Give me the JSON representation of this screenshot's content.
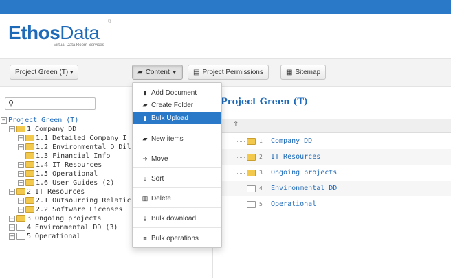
{
  "brand": {
    "word1": "Ethos",
    "word2": "Data",
    "tagline": "Virtual Data Room Services",
    "reg": "®"
  },
  "toolbar": {
    "room_select": "Project Green (T)",
    "content_label": "Content",
    "permissions_label": "Project Permissions",
    "sitemap_label": "Sitemap"
  },
  "menu": [
    {
      "label": "Add Document",
      "icon": "file-icon"
    },
    {
      "label": "Create Folder",
      "icon": "folder-icon"
    },
    {
      "label": "Bulk Upload",
      "icon": "files-icon",
      "highlighted": true
    },
    {
      "label": "New items",
      "icon": "new-folder-icon"
    },
    {
      "label": "Move",
      "icon": "arrow-right-icon"
    },
    {
      "label": "Sort",
      "icon": "arrow-down-icon"
    },
    {
      "label": "Delete",
      "icon": "trash-icon"
    },
    {
      "label": "Bulk download",
      "icon": "download-icon"
    },
    {
      "label": "Bulk operations",
      "icon": "list-icon"
    }
  ],
  "tree": {
    "root": "Project Green (T)",
    "items": [
      "1 Company DD",
      "1.1 Detailed Company I",
      "1.2 Environmental D Dil",
      "1.3 Financial Info",
      "1.4 IT Resources",
      "1.5 Operational",
      "1.6 User Guides (2)",
      "2 IT Resources",
      "2.1 Outsourcing Relatic",
      "2.2 Software Licenses",
      "3 Ongoing projects",
      "4 Environmental DD (3)",
      "5 Operational"
    ]
  },
  "main": {
    "title": "Project Green (T)",
    "rows": [
      {
        "num": "1",
        "name": "Company DD",
        "open": true
      },
      {
        "num": "2",
        "name": "IT Resources",
        "open": true
      },
      {
        "num": "3",
        "name": "Ongoing projects",
        "open": true
      },
      {
        "num": "4",
        "name": "Environmental DD",
        "open": false
      },
      {
        "num": "5",
        "name": "Operational",
        "open": false
      }
    ]
  },
  "colors": {
    "accent": "#2a78c8",
    "link": "#1e6ab8",
    "folder": "#f2c94c"
  }
}
